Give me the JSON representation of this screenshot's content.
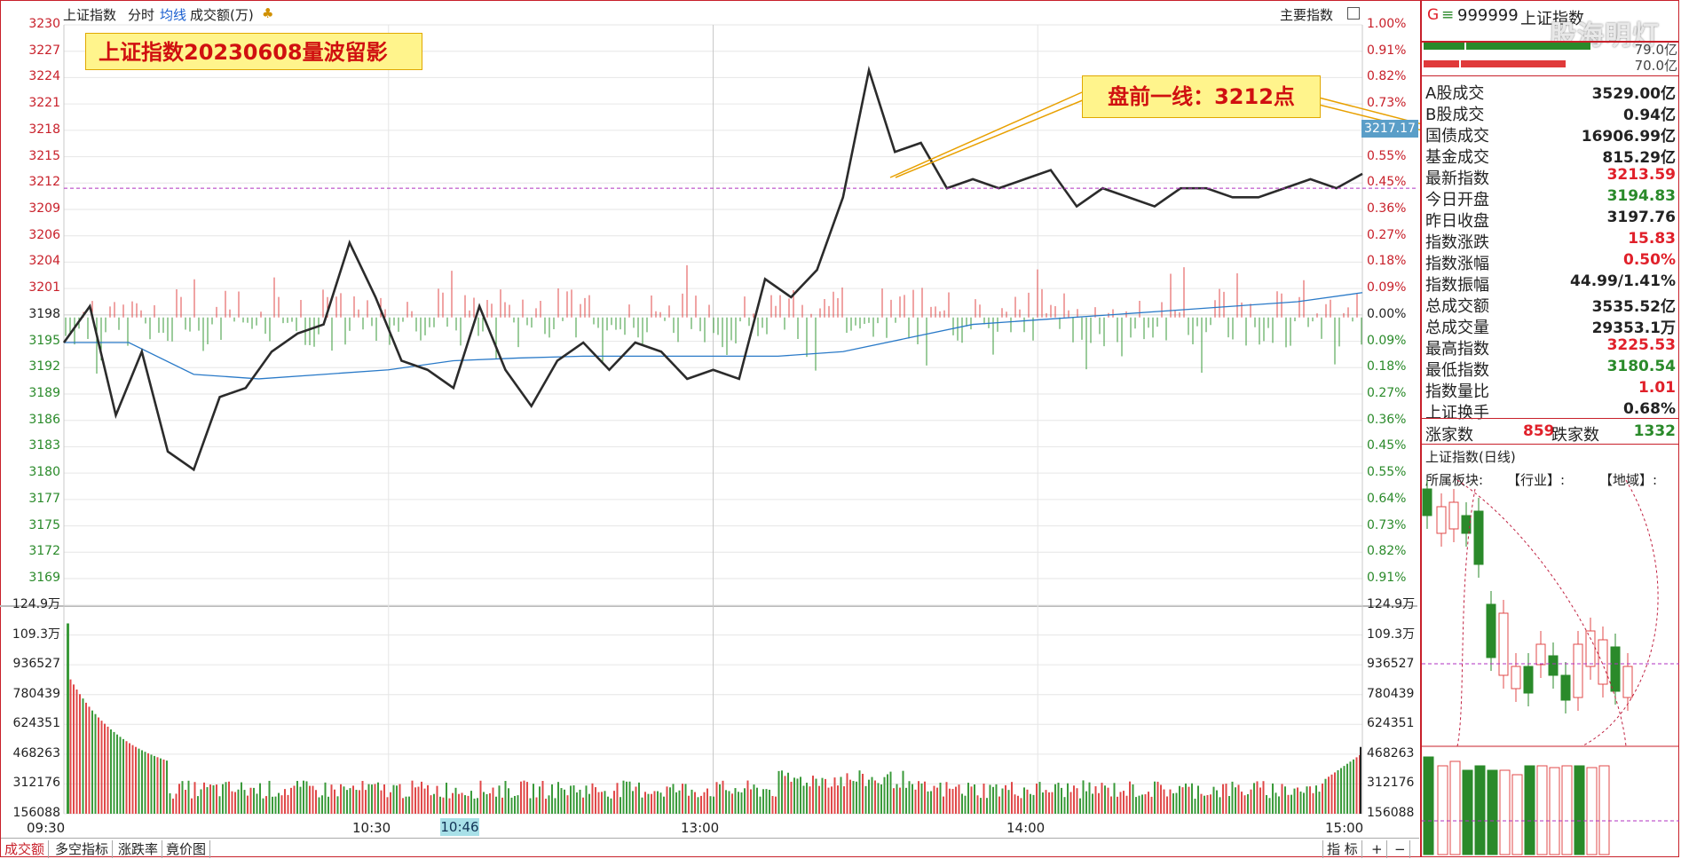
{
  "topbar": {
    "title": "上证指数",
    "tab_timeshare": "分时",
    "tab_avgline": "均线",
    "tab_volume": "成交额(万)",
    "main_indicator": "主要指数"
  },
  "annotations": {
    "title_box": "上证指数20230608量波留影",
    "premarket_line": "盘前一线：3212点",
    "price_tag": "3217.17",
    "time_tag": "10:46"
  },
  "price_axis": {
    "left": [
      "3230",
      "3227",
      "3224",
      "3221",
      "3218",
      "3215",
      "3212",
      "3209",
      "3206",
      "3204",
      "3201",
      "3198",
      "3195",
      "3192",
      "3189",
      "3186",
      "3183",
      "3180",
      "3177",
      "3175",
      "3172",
      "3169"
    ],
    "right": [
      "1.00%",
      "0.91%",
      "0.82%",
      "0.73%",
      "0.64%",
      "0.55%",
      "0.45%",
      "0.36%",
      "0.27%",
      "0.18%",
      "0.09%",
      "0.00%",
      "0.09%",
      "0.18%",
      "0.27%",
      "0.36%",
      "0.45%",
      "0.55%",
      "0.64%",
      "0.73%",
      "0.82%",
      "0.91%"
    ]
  },
  "volume_axis": {
    "left": [
      "124.9万",
      "109.3万",
      "936527",
      "780439",
      "624351",
      "468263",
      "312176",
      "156088"
    ],
    "right": [
      "124.9万",
      "109.3万",
      "936527",
      "780439",
      "624351",
      "468263",
      "312176",
      "156088"
    ]
  },
  "time_axis": [
    "09:30",
    "10:30",
    "13:00",
    "14:00",
    "15:00"
  ],
  "bottom_tabs": [
    "成交额",
    "多空指标",
    "涨跌率",
    "竟价图"
  ],
  "bottom_right": {
    "indicator": "指 标",
    "plus": "+",
    "minus": "−"
  },
  "right_panel": {
    "header_letter": "G",
    "header_code": "999999",
    "header_name": "上证指数",
    "header_extra": "股海明灯",
    "bar_val_1": "79.0亿",
    "bar_val_2": "70.0亿",
    "rows": [
      {
        "label": "A股成交",
        "value": "3529.00亿",
        "color": "black"
      },
      {
        "label": "B股成交",
        "value": "0.94亿",
        "color": "black"
      },
      {
        "label": "国债成交",
        "value": "16906.99亿",
        "color": "black"
      },
      {
        "label": "基金成交",
        "value": "815.29亿",
        "color": "black"
      },
      {
        "label": "最新指数",
        "value": "3213.59",
        "color": "red"
      },
      {
        "label": "今日开盘",
        "value": "3194.83",
        "color": "green"
      },
      {
        "label": "昨日收盘",
        "value": "3197.76",
        "color": "black"
      },
      {
        "label": "指数涨跌",
        "value": "15.83",
        "color": "red"
      },
      {
        "label": "指数涨幅",
        "value": "0.50%",
        "color": "red"
      },
      {
        "label": "指数振幅",
        "value": "44.99/1.41%",
        "color": "black"
      },
      {
        "label": "总成交额",
        "value": "3535.52亿",
        "color": "black"
      },
      {
        "label": "总成交量",
        "value": "29353.1万",
        "color": "black"
      },
      {
        "label": "最高指数",
        "value": "3225.53",
        "color": "red"
      },
      {
        "label": "最低指数",
        "value": "3180.54",
        "color": "green"
      },
      {
        "label": "指数量比",
        "value": "1.01",
        "color": "red"
      },
      {
        "label": "上证换手",
        "value": "0.68%",
        "color": "black"
      }
    ],
    "up_label": "涨家数",
    "up_value": "859",
    "down_label": "跌家数",
    "down_value": "1332",
    "daily_title": "上证指数(日线)",
    "sector_label": "所属板块:",
    "industry_label": "【行业】:",
    "region_label": "【地域】:"
  },
  "chart_data": {
    "type": "line",
    "title": "上证指数20230608量波留影",
    "ylim": [
      3169,
      3230
    ],
    "prev_close": 3197.76,
    "reference_line": 3212,
    "price_series": {
      "time_fraction": [
        0,
        0.02,
        0.04,
        0.06,
        0.08,
        0.1,
        0.12,
        0.14,
        0.16,
        0.18,
        0.2,
        0.22,
        0.24,
        0.26,
        0.28,
        0.3,
        0.32,
        0.34,
        0.36,
        0.38,
        0.4,
        0.42,
        0.44,
        0.46,
        0.48,
        0.5,
        0.52,
        0.54,
        0.56,
        0.58,
        0.6,
        0.62,
        0.64,
        0.66,
        0.68,
        0.7,
        0.72,
        0.74,
        0.76,
        0.78,
        0.8,
        0.82,
        0.84,
        0.86,
        0.88,
        0.9,
        0.92,
        0.94,
        0.96,
        0.98,
        1.0
      ],
      "values": [
        3195,
        3199,
        3187,
        3194,
        3183,
        3181,
        3189,
        3190,
        3194,
        3196,
        3197,
        3206,
        3200,
        3193,
        3192,
        3190,
        3199,
        3192,
        3188,
        3193,
        3195,
        3192,
        3195,
        3194,
        3191,
        3192,
        3191,
        3202,
        3200,
        3203,
        3211,
        3225,
        3216,
        3217,
        3212,
        3213,
        3212,
        3213,
        3214,
        3210,
        3212,
        3211,
        3210,
        3212,
        3212,
        3211,
        3211,
        3212,
        3213,
        3212,
        3213.59
      ]
    },
    "avg_series": {
      "time_fraction": [
        0,
        0.05,
        0.1,
        0.15,
        0.2,
        0.25,
        0.3,
        0.35,
        0.4,
        0.45,
        0.5,
        0.55,
        0.6,
        0.65,
        0.7,
        0.75,
        0.8,
        0.85,
        0.9,
        0.95,
        1.0
      ],
      "values": [
        3195,
        3195,
        3191.5,
        3191,
        3191.5,
        3192,
        3193,
        3193.3,
        3193.5,
        3193.5,
        3193.5,
        3193.5,
        3194,
        3195.5,
        3197,
        3197.5,
        3198,
        3198.5,
        3199,
        3199.5,
        3200.5
      ]
    },
    "volume_series_note": "成交额(万)",
    "volume_ylim": [
      0,
      1249000
    ]
  }
}
